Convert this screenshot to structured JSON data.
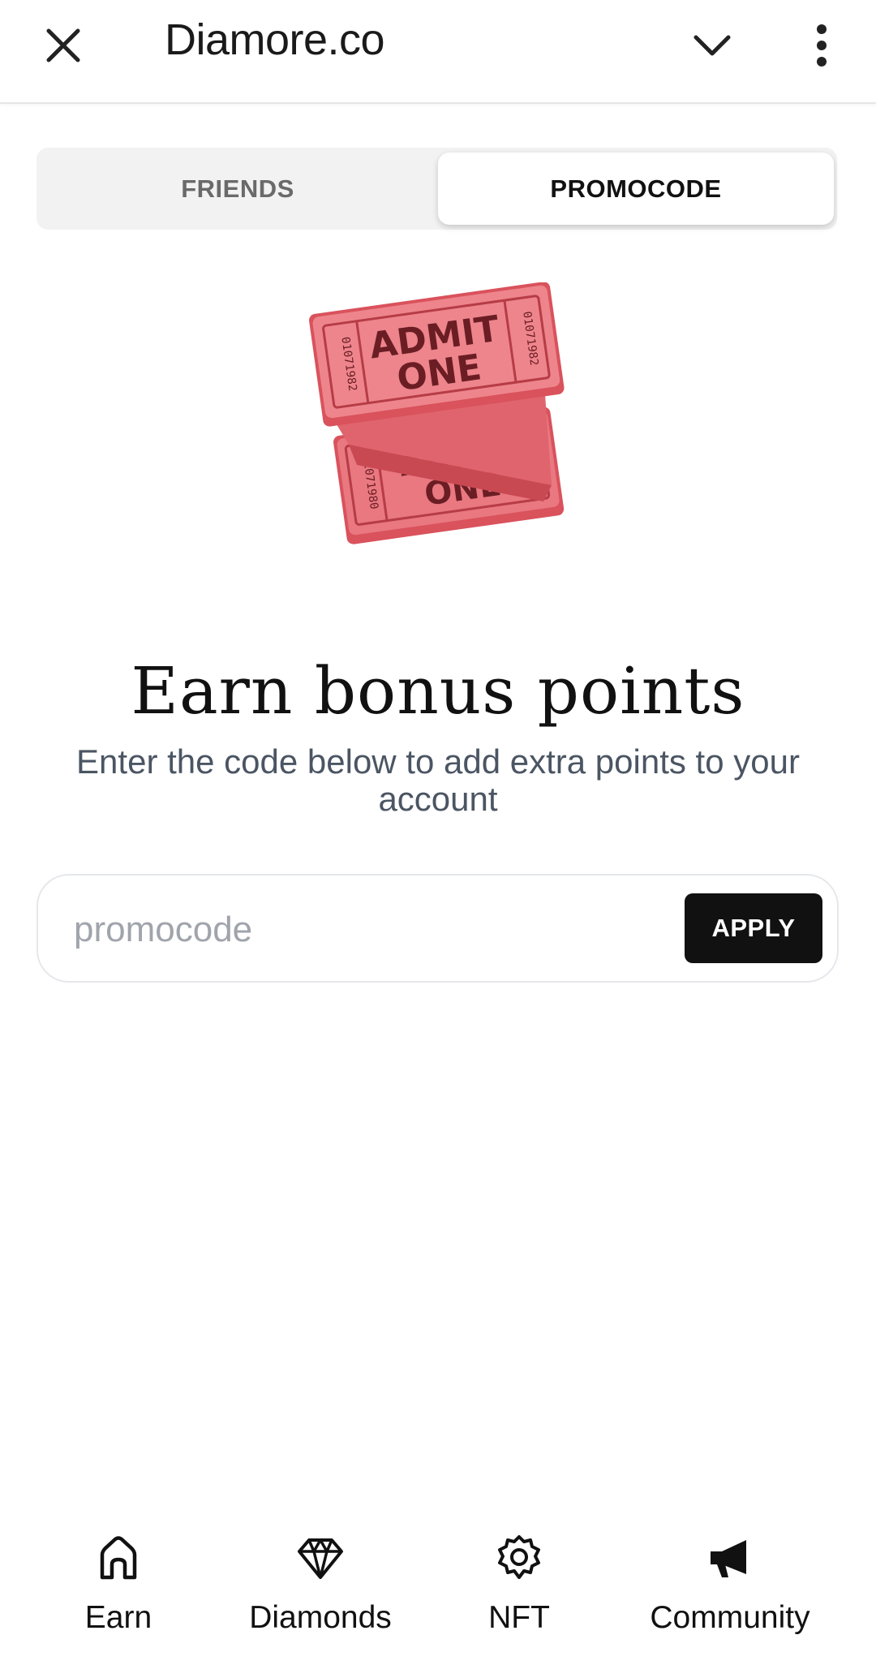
{
  "topbar": {
    "title": "Diamore.co",
    "close_icon": "close-icon",
    "dropdown_icon": "chevron-down-icon",
    "menu_icon": "more-vertical-icon"
  },
  "tabs": [
    {
      "label": "FRIENDS",
      "active": false
    },
    {
      "label": "PROMOCODE",
      "active": true
    }
  ],
  "illustration": {
    "icon": "admit-one-tickets",
    "ticket_text_line1": "ADMIT",
    "ticket_text_line2": "ONE",
    "serial": "01071982",
    "serial_lower": "01071980",
    "color": "#e46a72"
  },
  "headline": "Earn bonus points",
  "subtext": "Enter the code below to add extra points to your account",
  "promo": {
    "value": "",
    "placeholder": "promocode",
    "apply_label": "APPLY"
  },
  "bottom_nav": [
    {
      "label": "Earn",
      "icon": "home-icon"
    },
    {
      "label": "Diamonds",
      "icon": "diamond-icon"
    },
    {
      "label": "NFT",
      "icon": "gear-icon"
    },
    {
      "label": "Community",
      "icon": "megaphone-icon"
    }
  ],
  "colors": {
    "accent": "#111111",
    "muted_text": "#4b5563",
    "tab_bg": "#f2f2f2",
    "ticket": "#e46a72"
  }
}
